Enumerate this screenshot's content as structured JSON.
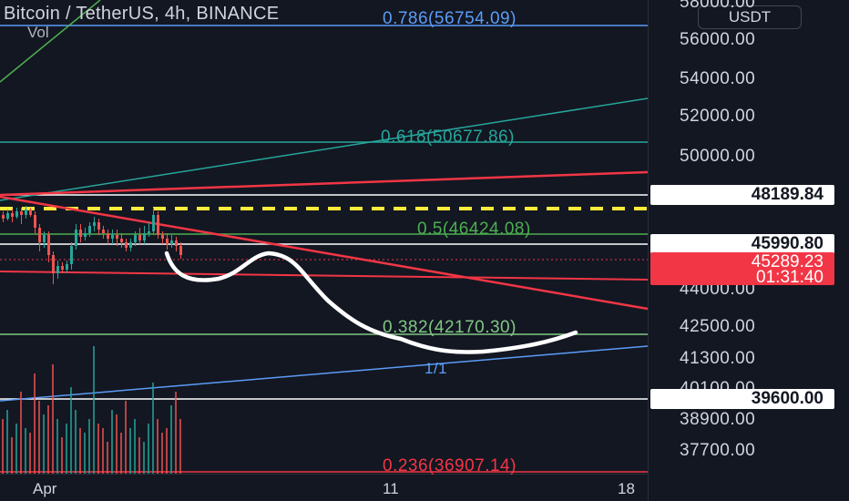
{
  "header": {
    "title": "Bitcoin / TetherUS, 4h, BINANCE",
    "volume_label": "Vol",
    "currency_button": "USDT"
  },
  "price_axis": {
    "ticks": [
      "58000.00",
      "56000.00",
      "54000.00",
      "52000.00",
      "50000.00",
      "44000.00",
      "42500.00",
      "41300.00",
      "40100.00",
      "38900.00",
      "37700.00"
    ],
    "highlighted_levels": [
      "48189.84",
      "45990.80",
      "39600.00"
    ],
    "last_price": "45289.23",
    "countdown": "01:31:40"
  },
  "time_axis": {
    "labels": [
      "Apr",
      "11",
      "18"
    ]
  },
  "fib_levels": [
    {
      "label": "0.786(56754.09)",
      "color": "#5b9cf6"
    },
    {
      "label": "0.618(50677.86)",
      "color": "#26a69a"
    },
    {
      "label": "0.5(46424.08)",
      "color": "#4caf50"
    },
    {
      "label": "0.382(42170.30)",
      "color": "#81c784"
    },
    {
      "label": "0.236(36907.14)",
      "color": "#f23645"
    }
  ],
  "annotations": {
    "channel_label": "1/1"
  },
  "colors": {
    "background": "#131722",
    "up": "#26a69a",
    "down": "#ef5350",
    "trendline": "#f23645",
    "dashed_level": "#ffeb3b",
    "drawing": "#ffffff"
  }
}
